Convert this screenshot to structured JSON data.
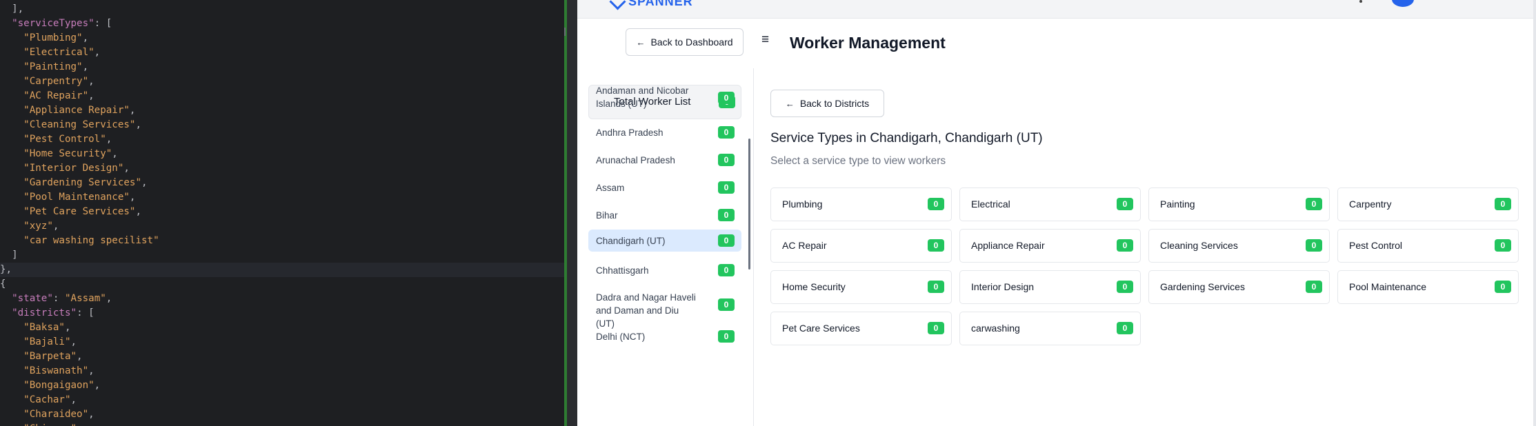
{
  "editor": {
    "lines": [
      {
        "t": "p",
        "text": "  ],"
      },
      {
        "t": "kv",
        "indent": "  ",
        "key": "\"serviceTypes\"",
        "rest": ": ["
      },
      {
        "t": "s",
        "indent": "    ",
        "text": "\"Plumbing\"",
        "tail": ","
      },
      {
        "t": "s",
        "indent": "    ",
        "text": "\"Electrical\"",
        "tail": ","
      },
      {
        "t": "s",
        "indent": "    ",
        "text": "\"Painting\"",
        "tail": ","
      },
      {
        "t": "s",
        "indent": "    ",
        "text": "\"Carpentry\"",
        "tail": ","
      },
      {
        "t": "s",
        "indent": "    ",
        "text": "\"AC Repair\"",
        "tail": ","
      },
      {
        "t": "s",
        "indent": "    ",
        "text": "\"Appliance Repair\"",
        "tail": ","
      },
      {
        "t": "s",
        "indent": "    ",
        "text": "\"Cleaning Services\"",
        "tail": ","
      },
      {
        "t": "s",
        "indent": "    ",
        "text": "\"Pest Control\"",
        "tail": ","
      },
      {
        "t": "s",
        "indent": "    ",
        "text": "\"Home Security\"",
        "tail": ","
      },
      {
        "t": "s",
        "indent": "    ",
        "text": "\"Interior Design\"",
        "tail": ","
      },
      {
        "t": "s",
        "indent": "    ",
        "text": "\"Gardening Services\"",
        "tail": ","
      },
      {
        "t": "s",
        "indent": "    ",
        "text": "\"Pool Maintenance\"",
        "tail": ","
      },
      {
        "t": "s",
        "indent": "    ",
        "text": "\"Pet Care Services\"",
        "tail": ","
      },
      {
        "t": "s",
        "indent": "    ",
        "text": "\"xyz\"",
        "tail": ","
      },
      {
        "t": "s",
        "indent": "    ",
        "text": "\"car washing specilist\"",
        "tail": ""
      },
      {
        "t": "p",
        "text": "  ]"
      },
      {
        "t": "p",
        "text": "},",
        "cur": true
      },
      {
        "t": "p",
        "text": "{"
      },
      {
        "t": "kvs",
        "indent": "  ",
        "key": "\"state\"",
        "sep": ": ",
        "val": "\"Assam\"",
        "tail": ","
      },
      {
        "t": "kv",
        "indent": "  ",
        "key": "\"districts\"",
        "rest": ": ["
      },
      {
        "t": "s",
        "indent": "    ",
        "text": "\"Baksa\"",
        "tail": ","
      },
      {
        "t": "s",
        "indent": "    ",
        "text": "\"Bajali\"",
        "tail": ","
      },
      {
        "t": "s",
        "indent": "    ",
        "text": "\"Barpeta\"",
        "tail": ","
      },
      {
        "t": "s",
        "indent": "    ",
        "text": "\"Biswanath\"",
        "tail": ","
      },
      {
        "t": "s",
        "indent": "    ",
        "text": "\"Bongaigaon\"",
        "tail": ","
      },
      {
        "t": "s",
        "indent": "    ",
        "text": "\"Cachar\"",
        "tail": ","
      },
      {
        "t": "s",
        "indent": "    ",
        "text": "\"Charaideo\"",
        "tail": ","
      },
      {
        "t": "s",
        "indent": "    ",
        "text": "\"Chirang\"",
        "tail": ","
      }
    ]
  },
  "app": {
    "logo_text": "SPANNER",
    "header": {
      "back_label": "Back to Dashboard",
      "menu_icon": "≡",
      "title": "Worker Management"
    },
    "sidebar": {
      "total_label": "Total Worker List",
      "total_count": "0",
      "states": [
        {
          "name": "Andaman and Nicobar Islands (UT)",
          "count": "0"
        },
        {
          "name": "Andhra Pradesh",
          "count": "0"
        },
        {
          "name": "Arunachal Pradesh",
          "count": "0"
        },
        {
          "name": "Assam",
          "count": "0"
        },
        {
          "name": "Bihar",
          "count": "0"
        },
        {
          "name": "Chandigarh (UT)",
          "count": "0",
          "active": true
        },
        {
          "name": "Chhattisgarh",
          "count": "0"
        },
        {
          "name": "Dadra and Nagar Haveli and Daman and Diu (UT)",
          "count": "0"
        },
        {
          "name": "Delhi (NCT)",
          "count": "0"
        }
      ]
    },
    "main": {
      "back_label": "Back to Districts",
      "title": "Service Types in Chandigarh, Chandigarh (UT)",
      "subtitle": "Select a service type to view workers",
      "services": [
        {
          "name": "Plumbing",
          "count": "0"
        },
        {
          "name": "Electrical",
          "count": "0"
        },
        {
          "name": "Painting",
          "count": "0"
        },
        {
          "name": "Carpentry",
          "count": "0"
        },
        {
          "name": "AC Repair",
          "count": "0"
        },
        {
          "name": "Appliance Repair",
          "count": "0"
        },
        {
          "name": "Cleaning Services",
          "count": "0"
        },
        {
          "name": "Pest Control",
          "count": "0"
        },
        {
          "name": "Home Security",
          "count": "0"
        },
        {
          "name": "Interior Design",
          "count": "0"
        },
        {
          "name": "Gardening Services",
          "count": "0"
        },
        {
          "name": "Pool Maintenance",
          "count": "0"
        },
        {
          "name": "Pet Care Services",
          "count": "0"
        },
        {
          "name": "carwashing",
          "count": "0"
        }
      ]
    }
  }
}
